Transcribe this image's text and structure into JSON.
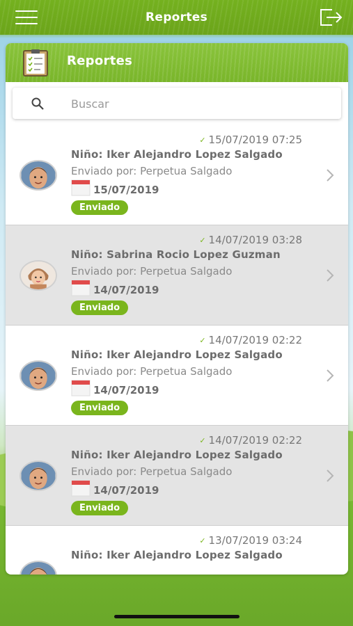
{
  "header": {
    "title": "Reportes"
  },
  "card": {
    "title": "Reportes"
  },
  "search": {
    "placeholder": "Buscar"
  },
  "colors": {
    "accent": "#7ab51d",
    "alt_row": "#e4e4e4"
  },
  "reports": [
    {
      "sent_at": "15/07/2019 07:25",
      "child": "Niño: Iker Alejandro Lopez Salgado",
      "sender": "Enviado por: Perpetua Salgado",
      "date": "15/07/2019",
      "status": "Enviado",
      "avatar": "boy-avatar"
    },
    {
      "sent_at": "14/07/2019 03:28",
      "child": "Niño: Sabrina Rocio Lopez Guzman",
      "sender": "Enviado por: Perpetua Salgado",
      "date": "14/07/2019",
      "status": "Enviado",
      "avatar": "baby-avatar"
    },
    {
      "sent_at": "14/07/2019 02:22",
      "child": "Niño: Iker Alejandro Lopez Salgado",
      "sender": "Enviado por: Perpetua Salgado",
      "date": "14/07/2019",
      "status": "Enviado",
      "avatar": "boy-avatar"
    },
    {
      "sent_at": "14/07/2019 02:22",
      "child": "Niño: Iker Alejandro Lopez Salgado",
      "sender": "Enviado por: Perpetua Salgado",
      "date": "14/07/2019",
      "status": "Enviado",
      "avatar": "boy-avatar"
    },
    {
      "sent_at": "13/07/2019 03:24",
      "child": "Niño: Iker Alejandro Lopez Salgado",
      "sender": "",
      "date": "",
      "status": "",
      "avatar": "boy-avatar"
    }
  ]
}
